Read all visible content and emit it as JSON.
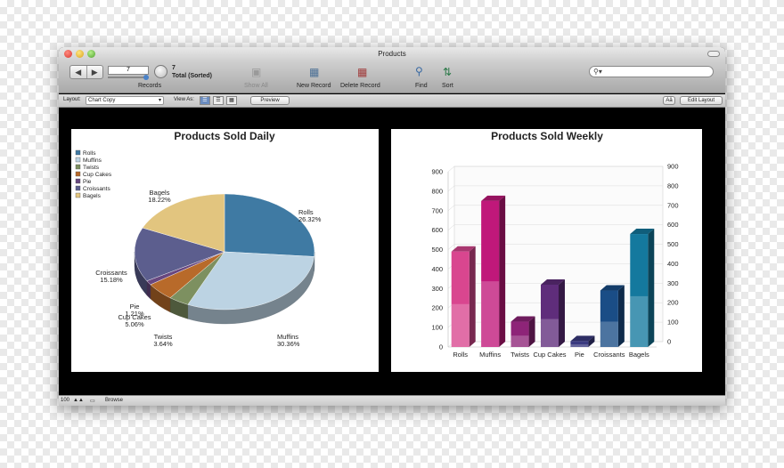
{
  "window": {
    "title": "Products"
  },
  "toolbar": {
    "record_number": "7",
    "records_label": "Records",
    "total_count": "7",
    "total_label": "Total (Sorted)",
    "show_all_label": "Show All",
    "new_record_label": "New Record",
    "delete_record_label": "Delete Record",
    "find_label": "Find",
    "sort_label": "Sort",
    "search_placeholder": "",
    "search_icon": "magnifier-icon"
  },
  "layout_bar": {
    "layout_label": "Layout:",
    "layout_value": "Chart Copy",
    "view_as_label": "View As:",
    "preview_label": "Preview",
    "aa_label": "Aâ",
    "edit_layout_label": "Edit Layout"
  },
  "status_bar": {
    "zoom": "100",
    "mode": "Browse"
  },
  "chart_data": [
    {
      "type": "pie",
      "title": "Products Sold Daily",
      "legend_placement": "top-left",
      "legend": [
        "Rolls",
        "Muffins",
        "Twists",
        "Cup Cakes",
        "Pie",
        "Croissants",
        "Bagels"
      ],
      "slices": [
        {
          "label": "Rolls",
          "value": 26.32,
          "text": "26.32%",
          "color": "#3f7aa3"
        },
        {
          "label": "Muffins",
          "value": 30.36,
          "text": "30.36%",
          "color": "#bcd3e3"
        },
        {
          "label": "Twists",
          "value": 3.64,
          "text": "3.64%",
          "color": "#7d9060"
        },
        {
          "label": "Cup Cakes",
          "value": 5.06,
          "text": "5.06%",
          "color": "#b86a2a"
        },
        {
          "label": "Pie",
          "value": 1.21,
          "text": "1.21%",
          "color": "#68477f"
        },
        {
          "label": "Croissants",
          "value": 15.18,
          "text": "15.18%",
          "color": "#5c5e8e"
        },
        {
          "label": "Bagels",
          "value": 18.22,
          "text": "18.22%",
          "color": "#e2c57f"
        }
      ]
    },
    {
      "type": "bar",
      "title": "Products Sold Weekly",
      "categories": [
        "Rolls",
        "Muffins",
        "Twists",
        "Cup Cakes",
        "Pie",
        "Croissants",
        "Bagels"
      ],
      "values": [
        490,
        750,
        130,
        320,
        30,
        290,
        580
      ],
      "colors": [
        "#d9468f",
        "#c0187a",
        "#8e2478",
        "#5f2d7b",
        "#3a3a80",
        "#1a4d86",
        "#14799e"
      ],
      "ylim": [
        0,
        900
      ],
      "yticks": [
        0,
        100,
        200,
        300,
        400,
        500,
        600,
        700,
        800,
        900
      ],
      "grid": true
    }
  ]
}
